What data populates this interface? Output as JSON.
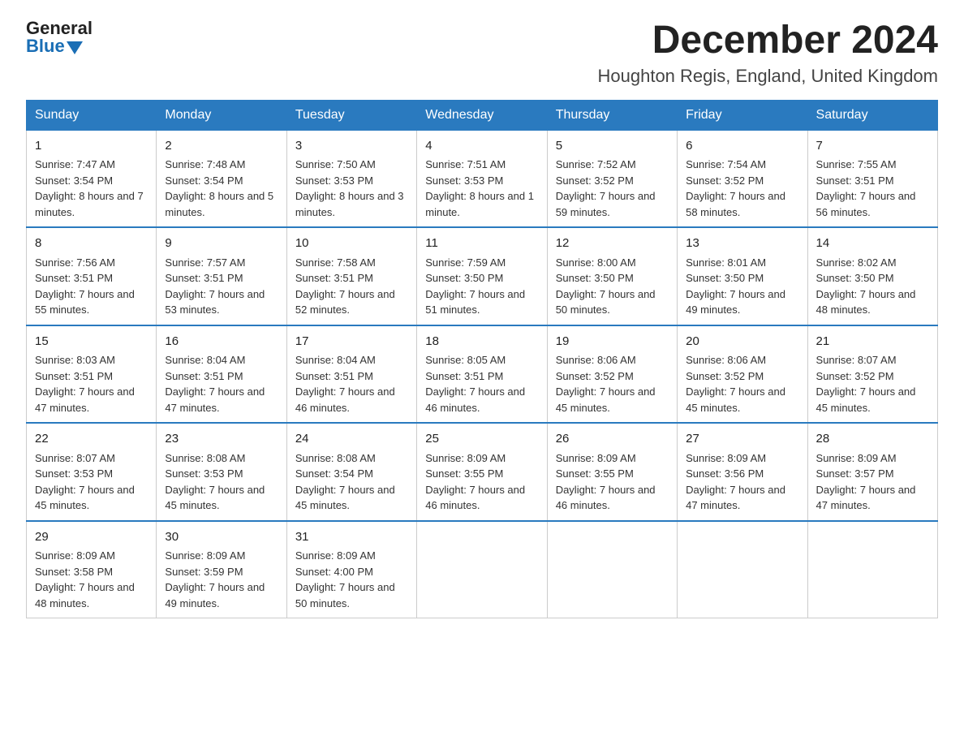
{
  "logo": {
    "general": "General",
    "blue": "Blue"
  },
  "title": {
    "month": "December 2024",
    "location": "Houghton Regis, England, United Kingdom"
  },
  "days_of_week": [
    "Sunday",
    "Monday",
    "Tuesday",
    "Wednesday",
    "Thursday",
    "Friday",
    "Saturday"
  ],
  "weeks": [
    [
      {
        "day": "1",
        "sunrise": "7:47 AM",
        "sunset": "3:54 PM",
        "daylight": "8 hours and 7 minutes."
      },
      {
        "day": "2",
        "sunrise": "7:48 AM",
        "sunset": "3:54 PM",
        "daylight": "8 hours and 5 minutes."
      },
      {
        "day": "3",
        "sunrise": "7:50 AM",
        "sunset": "3:53 PM",
        "daylight": "8 hours and 3 minutes."
      },
      {
        "day": "4",
        "sunrise": "7:51 AM",
        "sunset": "3:53 PM",
        "daylight": "8 hours and 1 minute."
      },
      {
        "day": "5",
        "sunrise": "7:52 AM",
        "sunset": "3:52 PM",
        "daylight": "7 hours and 59 minutes."
      },
      {
        "day": "6",
        "sunrise": "7:54 AM",
        "sunset": "3:52 PM",
        "daylight": "7 hours and 58 minutes."
      },
      {
        "day": "7",
        "sunrise": "7:55 AM",
        "sunset": "3:51 PM",
        "daylight": "7 hours and 56 minutes."
      }
    ],
    [
      {
        "day": "8",
        "sunrise": "7:56 AM",
        "sunset": "3:51 PM",
        "daylight": "7 hours and 55 minutes."
      },
      {
        "day": "9",
        "sunrise": "7:57 AM",
        "sunset": "3:51 PM",
        "daylight": "7 hours and 53 minutes."
      },
      {
        "day": "10",
        "sunrise": "7:58 AM",
        "sunset": "3:51 PM",
        "daylight": "7 hours and 52 minutes."
      },
      {
        "day": "11",
        "sunrise": "7:59 AM",
        "sunset": "3:50 PM",
        "daylight": "7 hours and 51 minutes."
      },
      {
        "day": "12",
        "sunrise": "8:00 AM",
        "sunset": "3:50 PM",
        "daylight": "7 hours and 50 minutes."
      },
      {
        "day": "13",
        "sunrise": "8:01 AM",
        "sunset": "3:50 PM",
        "daylight": "7 hours and 49 minutes."
      },
      {
        "day": "14",
        "sunrise": "8:02 AM",
        "sunset": "3:50 PM",
        "daylight": "7 hours and 48 minutes."
      }
    ],
    [
      {
        "day": "15",
        "sunrise": "8:03 AM",
        "sunset": "3:51 PM",
        "daylight": "7 hours and 47 minutes."
      },
      {
        "day": "16",
        "sunrise": "8:04 AM",
        "sunset": "3:51 PM",
        "daylight": "7 hours and 47 minutes."
      },
      {
        "day": "17",
        "sunrise": "8:04 AM",
        "sunset": "3:51 PM",
        "daylight": "7 hours and 46 minutes."
      },
      {
        "day": "18",
        "sunrise": "8:05 AM",
        "sunset": "3:51 PM",
        "daylight": "7 hours and 46 minutes."
      },
      {
        "day": "19",
        "sunrise": "8:06 AM",
        "sunset": "3:52 PM",
        "daylight": "7 hours and 45 minutes."
      },
      {
        "day": "20",
        "sunrise": "8:06 AM",
        "sunset": "3:52 PM",
        "daylight": "7 hours and 45 minutes."
      },
      {
        "day": "21",
        "sunrise": "8:07 AM",
        "sunset": "3:52 PM",
        "daylight": "7 hours and 45 minutes."
      }
    ],
    [
      {
        "day": "22",
        "sunrise": "8:07 AM",
        "sunset": "3:53 PM",
        "daylight": "7 hours and 45 minutes."
      },
      {
        "day": "23",
        "sunrise": "8:08 AM",
        "sunset": "3:53 PM",
        "daylight": "7 hours and 45 minutes."
      },
      {
        "day": "24",
        "sunrise": "8:08 AM",
        "sunset": "3:54 PM",
        "daylight": "7 hours and 45 minutes."
      },
      {
        "day": "25",
        "sunrise": "8:09 AM",
        "sunset": "3:55 PM",
        "daylight": "7 hours and 46 minutes."
      },
      {
        "day": "26",
        "sunrise": "8:09 AM",
        "sunset": "3:55 PM",
        "daylight": "7 hours and 46 minutes."
      },
      {
        "day": "27",
        "sunrise": "8:09 AM",
        "sunset": "3:56 PM",
        "daylight": "7 hours and 47 minutes."
      },
      {
        "day": "28",
        "sunrise": "8:09 AM",
        "sunset": "3:57 PM",
        "daylight": "7 hours and 47 minutes."
      }
    ],
    [
      {
        "day": "29",
        "sunrise": "8:09 AM",
        "sunset": "3:58 PM",
        "daylight": "7 hours and 48 minutes."
      },
      {
        "day": "30",
        "sunrise": "8:09 AM",
        "sunset": "3:59 PM",
        "daylight": "7 hours and 49 minutes."
      },
      {
        "day": "31",
        "sunrise": "8:09 AM",
        "sunset": "4:00 PM",
        "daylight": "7 hours and 50 minutes."
      },
      null,
      null,
      null,
      null
    ]
  ]
}
